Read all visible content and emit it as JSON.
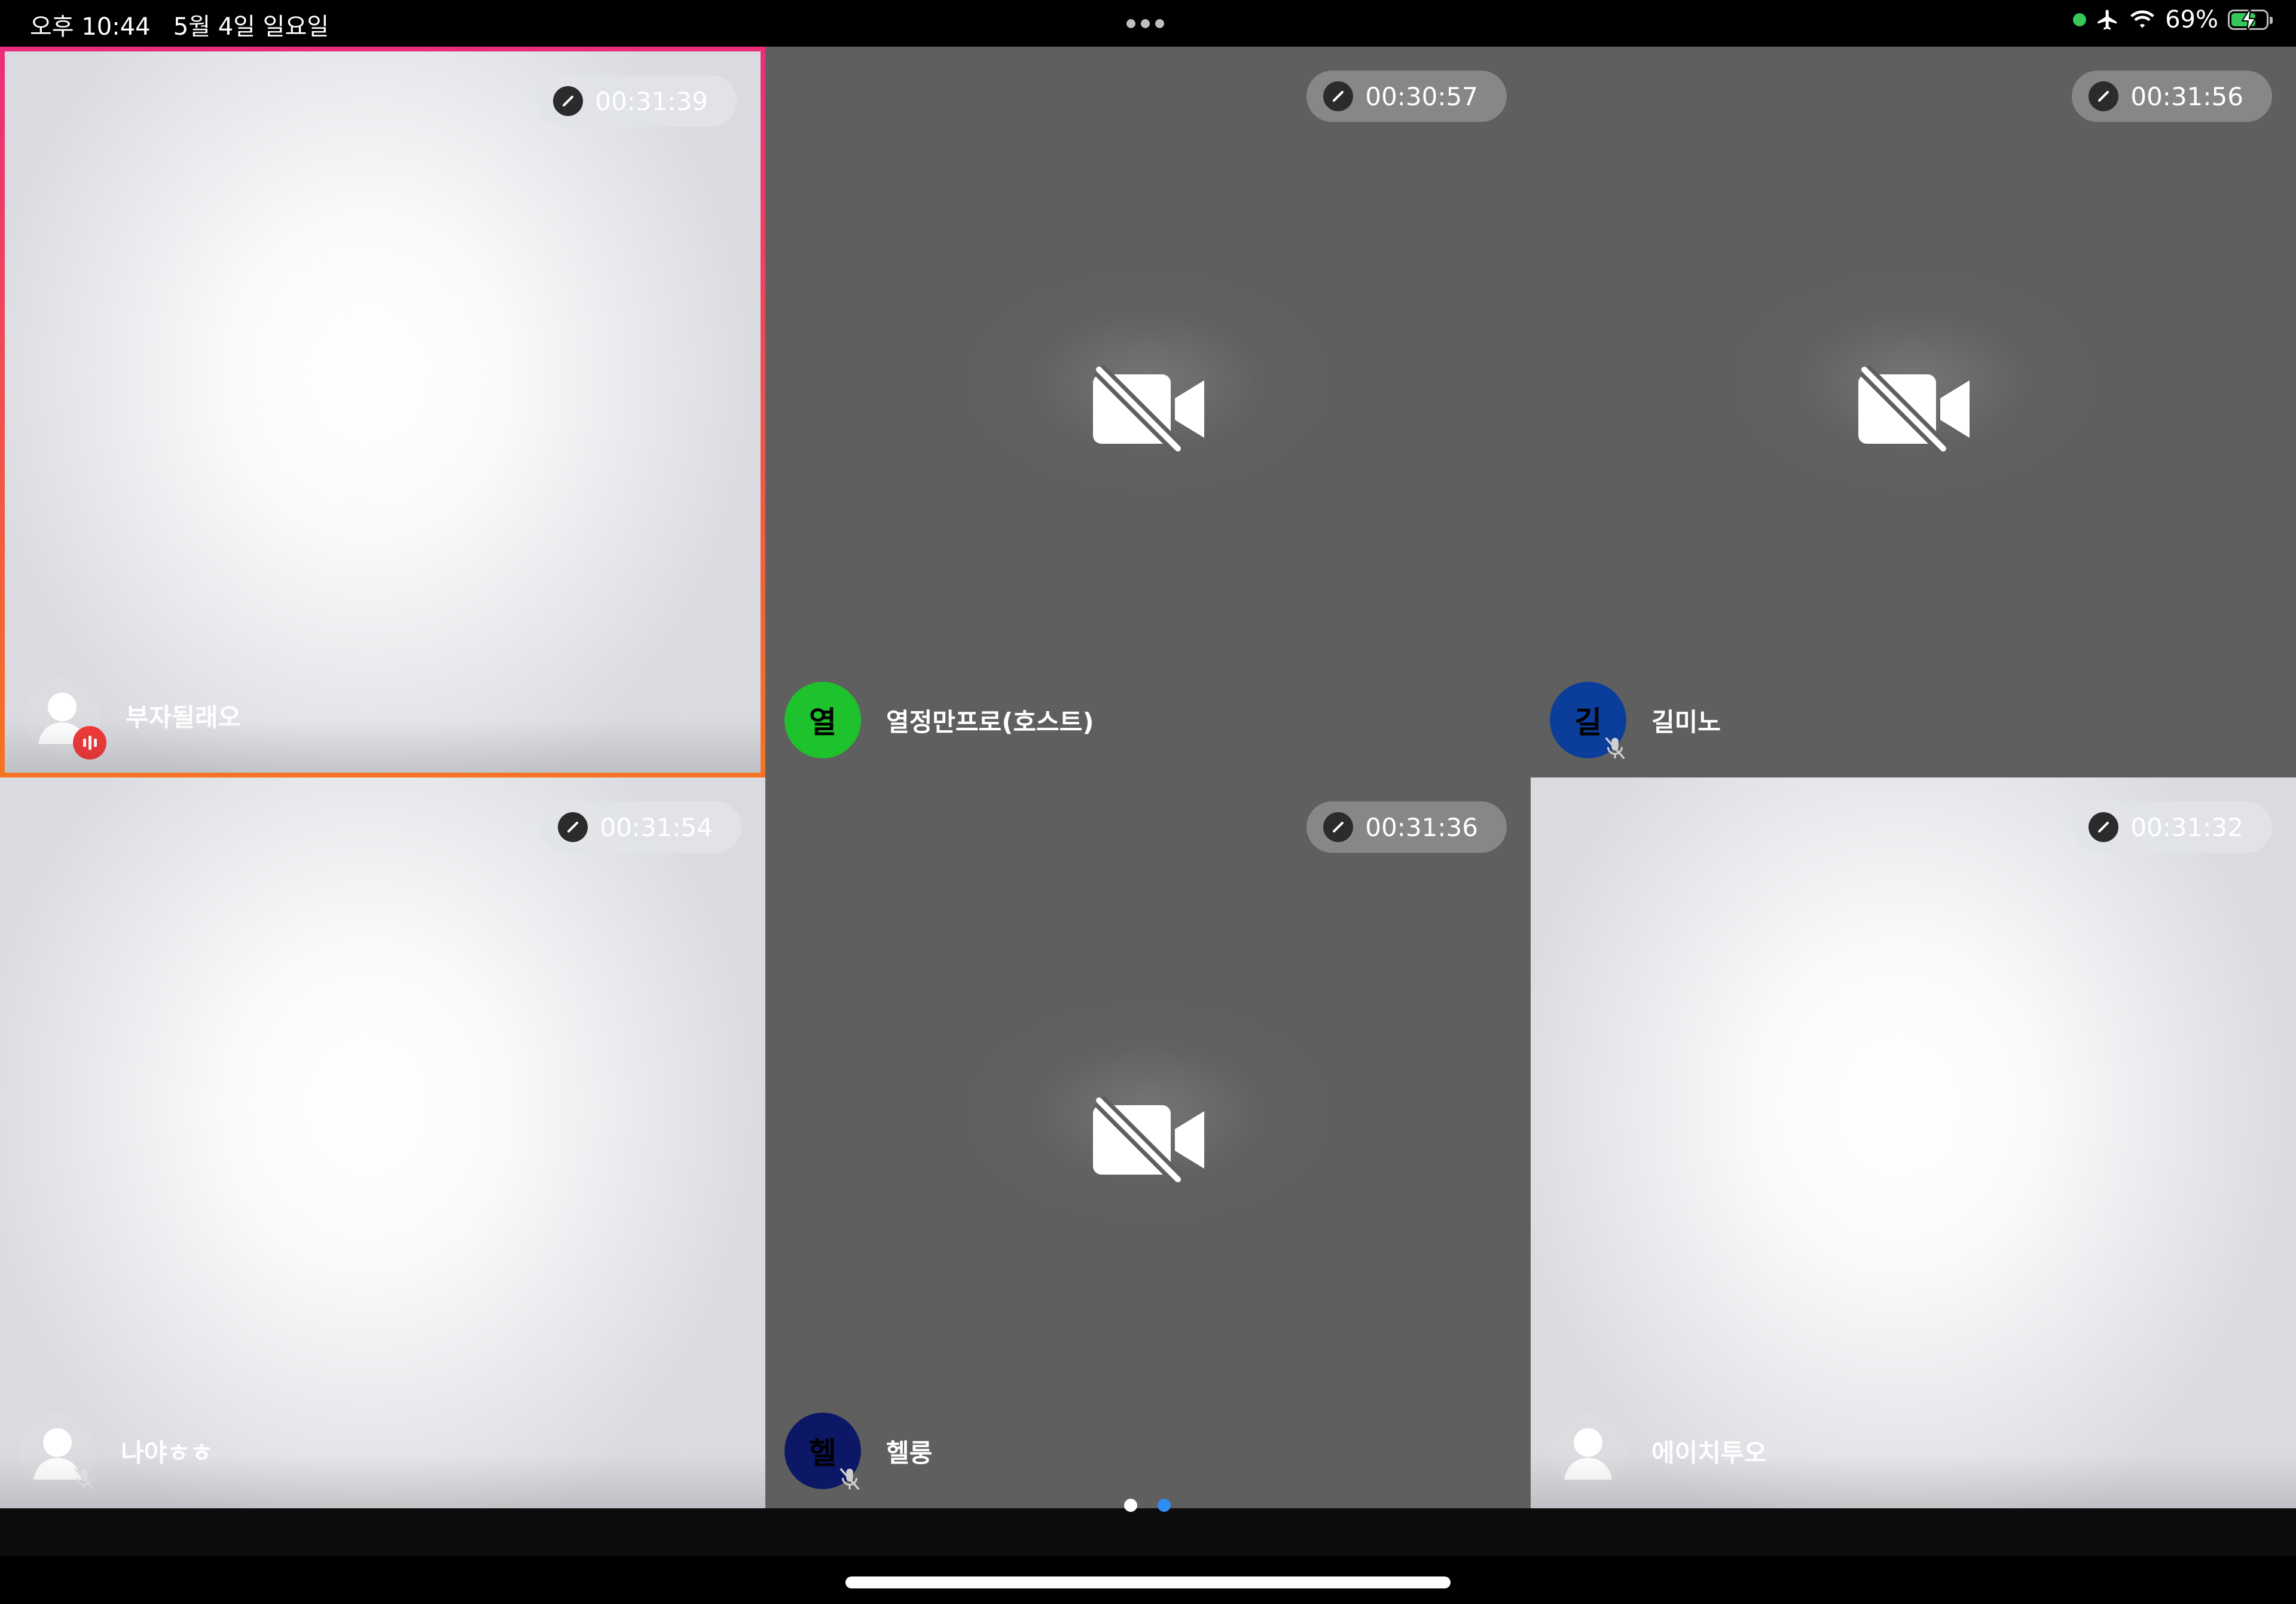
{
  "statusbar": {
    "time": "오후 10:44",
    "date": "5월 4일 일요일",
    "battery": "69%"
  },
  "tiles": [
    {
      "name": "부자될래오",
      "timer": "00:31:39",
      "video": "on",
      "avatar": "generic",
      "speaking": true,
      "muted": false,
      "highlight": true
    },
    {
      "name": "열정만프로(호스트)",
      "timer": "00:30:57",
      "video": "off",
      "avatar_letter": "열",
      "avatar_color": "#1dc22c",
      "muted": false
    },
    {
      "name": "길미노",
      "timer": "00:31:56",
      "video": "off",
      "avatar_letter": "길",
      "avatar_color": "#0a3e9a",
      "muted": true
    },
    {
      "name": "나야ㅎㅎ",
      "timer": "00:31:54",
      "video": "on",
      "avatar": "generic",
      "muted": true
    },
    {
      "name": "헬룽",
      "timer": "00:31:36",
      "video": "off",
      "avatar_letter": "헬",
      "avatar_color": "#0c1866",
      "muted": true
    },
    {
      "name": "에이치투오",
      "timer": "00:31:32",
      "video": "on",
      "avatar": "generic",
      "muted": false
    }
  ],
  "pager": {
    "pages": 2,
    "current": 2,
    "active_color": "#2f8cf5",
    "inactive_color": "#ffffff"
  }
}
